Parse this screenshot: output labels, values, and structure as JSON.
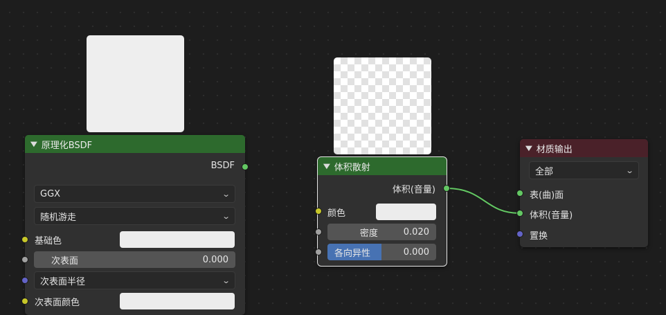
{
  "nodes": {
    "principled": {
      "title": "原理化BSDF",
      "output_label": "BSDF",
      "distribution": "GGX",
      "subsurface_method": "随机游走",
      "base_color_label": "基础色",
      "subsurface_label": "次表面",
      "subsurface_value": "0.000",
      "subsurface_radius_label": "次表面半径",
      "subsurface_color_label": "次表面颜色"
    },
    "volume_scatter": {
      "title": "体积散射",
      "output_label": "体积(音量)",
      "color_label": "颜色",
      "density_label": "密度",
      "density_value": "0.020",
      "anisotropy_label": "各向异性",
      "anisotropy_value": "0.000"
    },
    "material_output": {
      "title": "材质输出",
      "target": "全部",
      "surface_label": "表(曲)面",
      "volume_label": "体积(音量)",
      "displacement_label": "置换"
    }
  },
  "colors": {
    "shader_socket": "#63c763",
    "color_socket": "#c7c729",
    "float_socket": "#a1a1a1",
    "vector_socket": "#6363c7",
    "shader_header": "#2d6a2d",
    "output_header": "#4a2129",
    "link": "#63c763",
    "slider_fill": "#4772b3"
  },
  "icons": {
    "collapse": "chevron-down-icon",
    "dropdown": "chevron-down-icon"
  }
}
